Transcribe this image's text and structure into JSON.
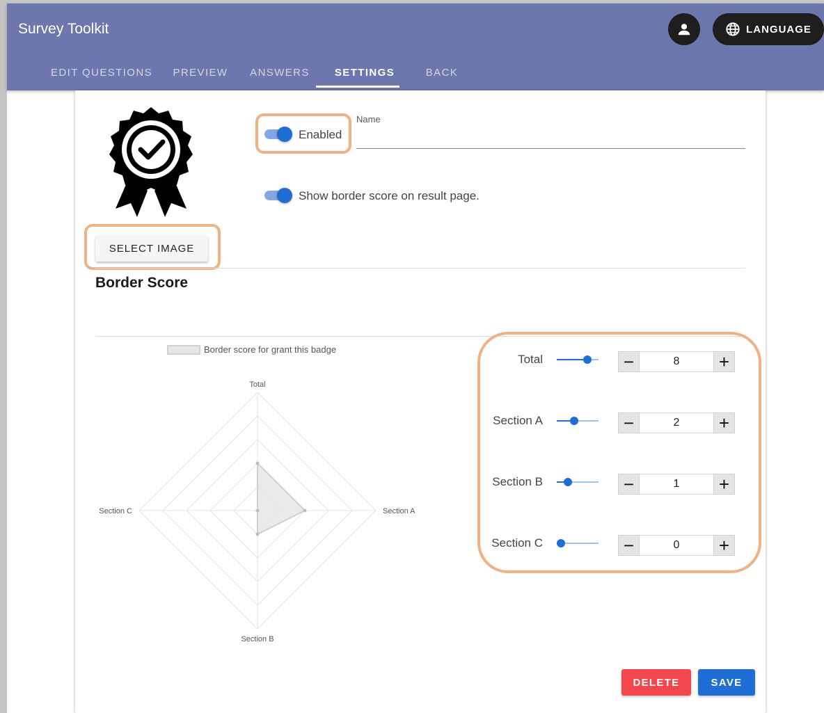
{
  "app": {
    "title": "Survey Toolkit"
  },
  "header": {
    "user_icon": "account-icon",
    "language_icon": "globe-icon",
    "language_label": "LANGUAGE"
  },
  "tabs": [
    {
      "label": "EDIT QUESTIONS",
      "active": false
    },
    {
      "label": "PREVIEW",
      "active": false
    },
    {
      "label": "ANSWERS",
      "active": false
    },
    {
      "label": "SETTINGS",
      "active": true
    },
    {
      "label": "BACK",
      "active": false
    }
  ],
  "badge": {
    "icon": "award-badge-icon",
    "select_image_label": "SELECT IMAGE",
    "enabled_label": "Enabled",
    "enabled": true,
    "name_label": "Name",
    "name_value": "",
    "show_border_label": "Show border score on result page.",
    "show_border": true
  },
  "border_score": {
    "title": "Border Score",
    "items": [
      {
        "label": "Total",
        "value": "8",
        "fraction": 0.8
      },
      {
        "label": "Section A",
        "value": "2",
        "fraction": 0.4
      },
      {
        "label": "Section B",
        "value": "1",
        "fraction": 0.2
      },
      {
        "label": "Section C",
        "value": "0",
        "fraction": 0.0
      }
    ]
  },
  "chart_data": {
    "type": "radar",
    "axes": [
      "Total",
      "Section A",
      "Section B",
      "Section C"
    ],
    "series": [
      {
        "name": "Border score for grant this badge",
        "values": [
          8,
          2,
          1,
          0
        ]
      }
    ],
    "axis_maxima": [
      20,
      5,
      5,
      5
    ],
    "rings": 5,
    "legend": "top",
    "colors": {
      "fill": "#e6e6e6",
      "stroke": "#cfcfcf",
      "grid": "#e4e4e4"
    }
  },
  "actions": {
    "delete_label": "DELETE",
    "save_label": "SAVE"
  },
  "colors": {
    "appbar": "#6c77ad",
    "primary": "#1e6ed6",
    "danger": "#f4474d",
    "highlight": "#f2b183"
  }
}
